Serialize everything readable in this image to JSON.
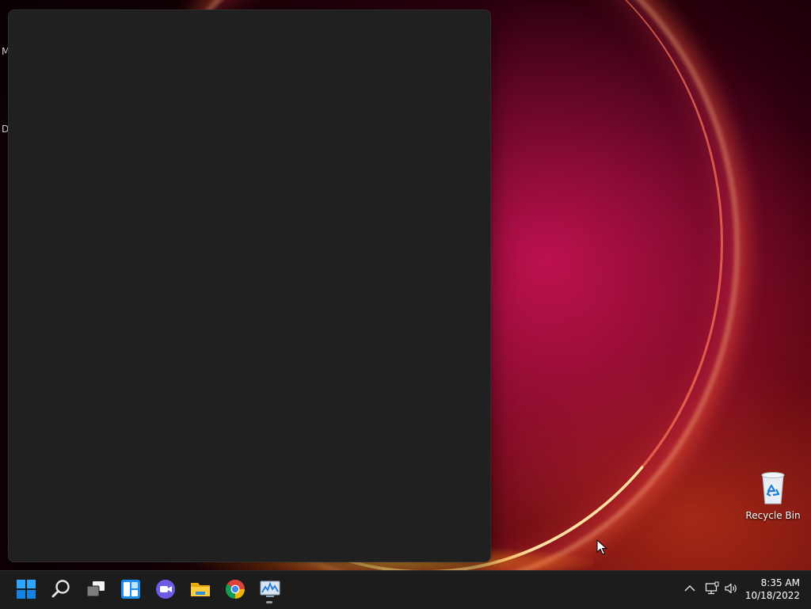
{
  "desktop": {
    "edge_labels": [
      "M",
      "D"
    ],
    "icons": [
      {
        "name": "recycle-bin",
        "label": "Recycle Bin"
      }
    ]
  },
  "taskbar": {
    "apps": [
      {
        "id": "start",
        "icon": "windows-logo-icon"
      },
      {
        "id": "search",
        "icon": "search-icon"
      },
      {
        "id": "task-view",
        "icon": "task-view-icon"
      },
      {
        "id": "widgets",
        "icon": "widgets-icon"
      },
      {
        "id": "chat",
        "icon": "teams-chat-icon"
      },
      {
        "id": "file-explorer",
        "icon": "folder-icon"
      },
      {
        "id": "chrome",
        "icon": "chrome-icon"
      },
      {
        "id": "performance-monitor",
        "icon": "chart-monitor-icon",
        "active": true
      }
    ],
    "tray": {
      "icons": [
        "chevron-up-icon",
        "network-icon",
        "volume-icon"
      ],
      "time": "8:35 AM",
      "date": "10/18/2022"
    }
  },
  "colors": {
    "taskbar": "#1c1c1c",
    "panel": "#202020",
    "accent": "#0078d4"
  }
}
